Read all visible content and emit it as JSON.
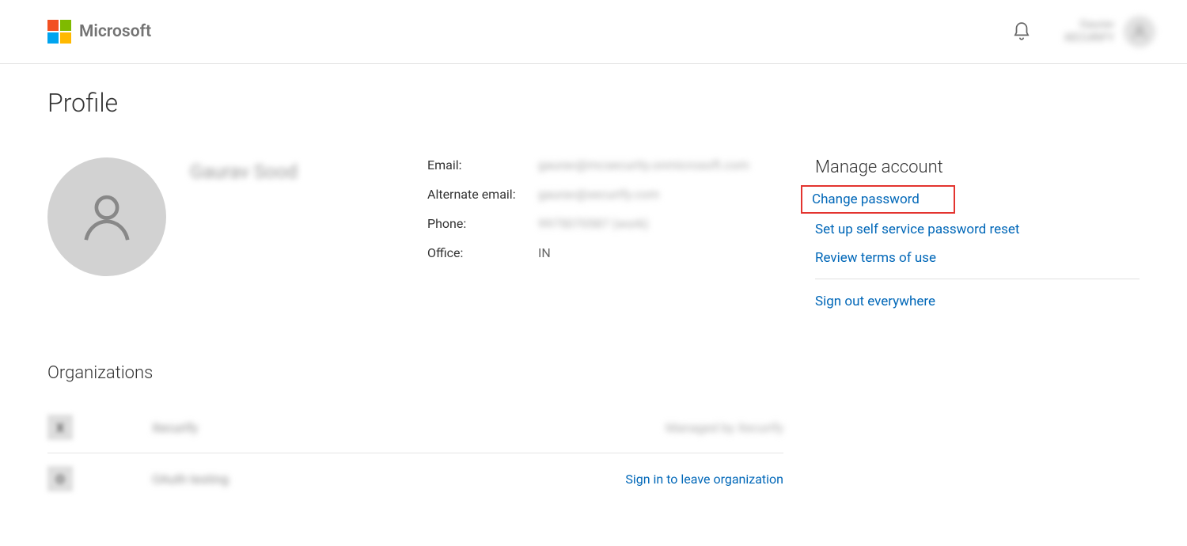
{
  "header": {
    "brand": "Microsoft",
    "user_name": "Gaurav",
    "user_org": "XECURIFY"
  },
  "page": {
    "title": "Profile"
  },
  "profile": {
    "display_name": "Gaurav Sood",
    "contact": {
      "email_label": "Email:",
      "email_value": "gaurav@mcsecurity.onmicrosoft.com",
      "alt_email_label": "Alternate email:",
      "alt_email_value": "gaurav@xecurify.com",
      "phone_label": "Phone:",
      "phone_value": "9975070587 (work)",
      "office_label": "Office:",
      "office_value": "IN"
    }
  },
  "manage": {
    "title": "Manage account",
    "links": {
      "change_password": "Change password",
      "sspr": "Set up self service password reset",
      "terms": "Review terms of use",
      "signout": "Sign out everywhere"
    }
  },
  "organizations": {
    "title": "Organizations",
    "rows": [
      {
        "badge": "X",
        "name": "Xecurify",
        "action": "Managed by Xecurify"
      },
      {
        "badge": "O",
        "name": "OAuth testing",
        "action": "Sign in to leave organization"
      }
    ]
  }
}
